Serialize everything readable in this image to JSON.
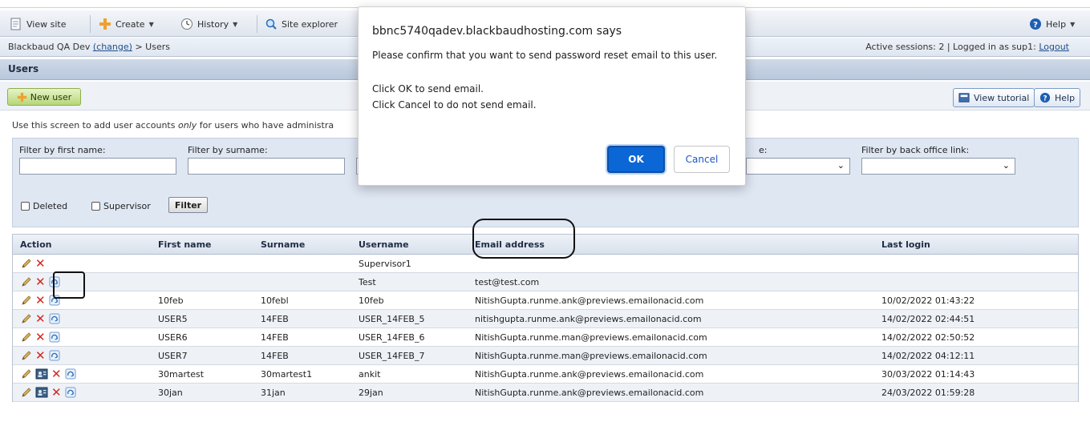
{
  "toolbar": {
    "view_site": "View site",
    "create": "Create",
    "history": "History",
    "site_explorer": "Site explorer",
    "help": "Help"
  },
  "breadcrumb": {
    "site": "Blackbaud QA Dev",
    "change": "(change)",
    "separator": ">",
    "page": "Users",
    "sessions": "Active sessions: 2 | Logged in as sup1:",
    "logout": "Logout"
  },
  "section_title": "Users",
  "actions": {
    "new_user": "New user",
    "view_tutorial": "View tutorial",
    "help": "Help"
  },
  "intro": {
    "before": "Use this screen to add user accounts ",
    "em": "only",
    "after": " for users who have administra"
  },
  "filters": {
    "first_name_label": "Filter by first name:",
    "surname_label": "Filter by surname:",
    "partial_label": "e:",
    "back_office_label": "Filter by back office link:",
    "deleted": "Deleted",
    "supervisor": "Supervisor",
    "filter_button": "Filter"
  },
  "grid": {
    "headers": {
      "action": "Action",
      "first_name": "First name",
      "surname": "Surname",
      "username": "Username",
      "email": "Email address",
      "last_login": "Last login"
    },
    "rows": [
      {
        "first": "",
        "surname": "",
        "username": "Supervisor1",
        "email": "",
        "last_login": ""
      },
      {
        "first": "",
        "surname": "",
        "username": "Test",
        "email": "test@test.com",
        "last_login": ""
      },
      {
        "first": "10feb",
        "surname": "10febl",
        "username": "10feb",
        "email": "NitishGupta.runme.ank@previews.emailonacid.com",
        "last_login": "10/02/2022 01:43:22"
      },
      {
        "first": "USER5",
        "surname": "14FEB",
        "username": "USER_14FEB_5",
        "email": "nitishgupta.runme.ank@previews.emailonacid.com",
        "last_login": "14/02/2022 02:44:51"
      },
      {
        "first": "USER6",
        "surname": "14FEB",
        "username": "USER_14FEB_6",
        "email": "NitishGupta.runme.man@previews.emailonacid.com",
        "last_login": "14/02/2022 02:50:52"
      },
      {
        "first": "USER7",
        "surname": "14FEB",
        "username": "USER_14FEB_7",
        "email": "NitishGupta.runme.man@previews.emailonacid.com",
        "last_login": "14/02/2022 04:12:11"
      },
      {
        "first": "30martest",
        "surname": "30martest1",
        "username": "ankit",
        "email": "NitishGupta.runme.ank@previews.emailonacid.com",
        "last_login": "30/03/2022 01:14:43"
      },
      {
        "first": "30jan",
        "surname": "31jan",
        "username": "29jan",
        "email": "NitishGupta.runme.ank@previews.emailonacid.com",
        "last_login": "24/03/2022 01:59:28"
      }
    ]
  },
  "dialog": {
    "title": "bbnc5740qadev.blackbaudhosting.com says",
    "message": "Please confirm that you want to send password reset email to this user.",
    "ok_hint": "Click OK to send email.",
    "cancel_hint": "Click Cancel to do not send email.",
    "ok": "OK",
    "cancel": "Cancel"
  },
  "colors": {
    "accent": "#0b66d6",
    "delete": "#d3281c",
    "header_blue": "#b9c8dd"
  }
}
